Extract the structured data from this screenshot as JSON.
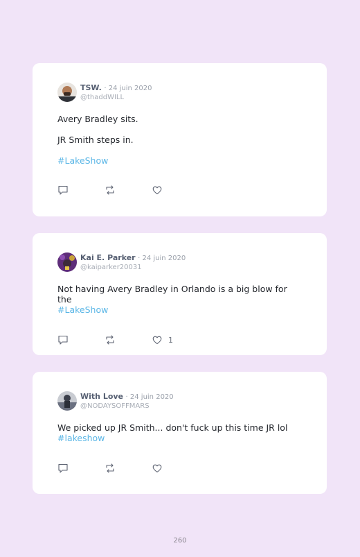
{
  "tweets": [
    {
      "name": "TSW.",
      "date": "· 24 juin 2020",
      "handle": "@thaddWILL",
      "lines": [
        "Avery Bradley sits.",
        "JR Smith steps in."
      ],
      "hashtag": "#LakeShow",
      "likes": ""
    },
    {
      "name": "Kai E. Parker",
      "date": "· 24 juin 2020",
      "handle": "@kaiparker20031",
      "text": "Not having Avery Bradley in Orlando is a big blow for the",
      "hashtag": "#LakeShow",
      "likes": "1"
    },
    {
      "name": "With Love",
      "date": "· 24 juin 2020",
      "handle": "@NODAYSOFFMARS",
      "text": "We picked up JR Smith... don't fuck up this time JR lol",
      "hashtag": "#lakeshow",
      "likes": ""
    }
  ],
  "page_number": "260",
  "icons": {
    "reply": "comment-icon",
    "retweet": "retweet-icon",
    "like": "heart-icon"
  },
  "colors": {
    "background": "#f1e4f8",
    "card": "#ffffff",
    "hashtag": "#5ab6e6"
  }
}
